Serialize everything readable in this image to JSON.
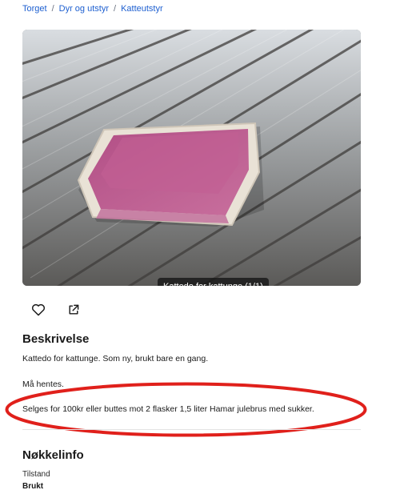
{
  "breadcrumb": {
    "items": [
      "Torget",
      "Dyr og utstyr",
      "Katteutstyr"
    ],
    "separator": "/"
  },
  "gallery": {
    "caption": "Kattedo for kattunge (1/1)"
  },
  "actions": {
    "favorite_icon": "heart-icon",
    "share_icon": "share-icon"
  },
  "description": {
    "title": "Beskrivelse",
    "line1": "Kattedo for kattunge. Som ny, brukt bare en gang.",
    "line2": "Må hentes.",
    "line3": "Selges for 100kr eller buttes mot 2 flasker 1,5 liter Hamar julebrus med sukker."
  },
  "annotation": {
    "color": "#e0201b"
  },
  "key_info": {
    "title": "Nøkkelinfo",
    "condition_label": "Tilstand",
    "condition_value": "Brukt"
  },
  "colors": {
    "link": "#1d5fd0",
    "text": "#1a1a1a"
  }
}
